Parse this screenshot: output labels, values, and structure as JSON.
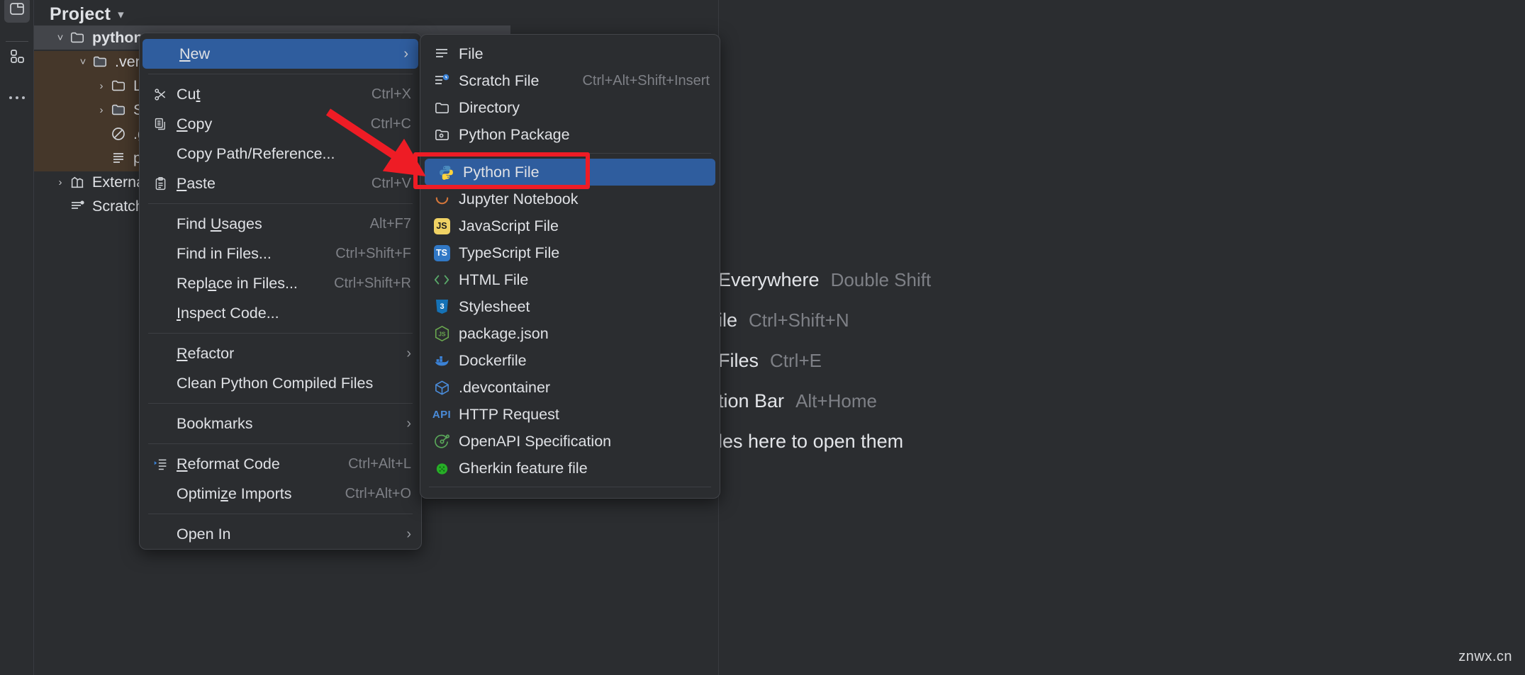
{
  "activity_bar": {
    "items": [
      {
        "name": "project-tool-window",
        "icon": "folder-icon",
        "selected": true
      },
      {
        "name": "structure-tool-window",
        "icon": "grid-squares-icon",
        "selected": false
      },
      {
        "name": "more-tool-windows",
        "icon": "ellipsis-icon",
        "selected": false
      }
    ]
  },
  "project_panel": {
    "title": "Project",
    "dropdown_icon": "chevron-down-icon",
    "tree": [
      {
        "label": "python",
        "bold": true,
        "expanded": true,
        "arrow": "chevron-down-icon",
        "icon": "folder-icon",
        "indent": 0,
        "selected": true,
        "highlighted": false
      },
      {
        "label": ".ven",
        "bold": false,
        "expanded": true,
        "arrow": "chevron-down-icon",
        "icon": "folder-icon",
        "indent": 1,
        "selected": false,
        "highlighted": true
      },
      {
        "label": "L",
        "bold": false,
        "expanded": false,
        "arrow": "chevron-right-icon",
        "icon": "folder-icon",
        "indent": 2,
        "selected": false,
        "highlighted": true
      },
      {
        "label": "S",
        "bold": false,
        "expanded": false,
        "arrow": "chevron-right-icon",
        "icon": "folder-icon",
        "indent": 2,
        "selected": false,
        "highlighted": true
      },
      {
        "label": ".g",
        "bold": false,
        "expanded": false,
        "arrow": "",
        "icon": "ignored-file-icon",
        "indent": 2,
        "selected": false,
        "highlighted": true
      },
      {
        "label": "p",
        "bold": false,
        "expanded": false,
        "arrow": "",
        "icon": "text-file-icon",
        "indent": 2,
        "selected": false,
        "highlighted": true
      },
      {
        "label": "Externa",
        "bold": false,
        "expanded": false,
        "arrow": "chevron-right-icon",
        "icon": "library-icon",
        "indent": 0,
        "selected": false,
        "highlighted": false
      },
      {
        "label": "Scratch",
        "bold": false,
        "expanded": false,
        "arrow": "",
        "icon": "scratch-icon",
        "indent": 0,
        "selected": false,
        "highlighted": false
      }
    ]
  },
  "context_menu": {
    "items": [
      {
        "type": "item",
        "label": "New",
        "mnemonic": "N",
        "icon": "",
        "shortcut": "",
        "submenu_arrow": "chevron-right-icon",
        "active": true
      },
      {
        "type": "separator"
      },
      {
        "type": "item",
        "label": "Cut",
        "mnemonic": "t",
        "icon": "scissors-icon",
        "shortcut": "Ctrl+X",
        "submenu_arrow": "",
        "active": false
      },
      {
        "type": "item",
        "label": "Copy",
        "mnemonic": "C",
        "icon": "copy-icon",
        "shortcut": "Ctrl+C",
        "submenu_arrow": "",
        "active": false
      },
      {
        "type": "item",
        "label": "Copy Path/Reference...",
        "mnemonic": "",
        "icon": "",
        "shortcut": "",
        "submenu_arrow": "",
        "active": false
      },
      {
        "type": "item",
        "label": "Paste",
        "mnemonic": "P",
        "icon": "clipboard-icon",
        "shortcut": "Ctrl+V",
        "submenu_arrow": "",
        "active": false
      },
      {
        "type": "separator"
      },
      {
        "type": "item",
        "label": "Find Usages",
        "mnemonic": "U",
        "icon": "",
        "shortcut": "Alt+F7",
        "submenu_arrow": "",
        "active": false
      },
      {
        "type": "item",
        "label": "Find in Files...",
        "mnemonic": "",
        "icon": "",
        "shortcut": "Ctrl+Shift+F",
        "submenu_arrow": "",
        "active": false
      },
      {
        "type": "item",
        "label": "Replace in Files...",
        "mnemonic": "a",
        "icon": "",
        "shortcut": "Ctrl+Shift+R",
        "submenu_arrow": "",
        "active": false
      },
      {
        "type": "item",
        "label": "Inspect Code...",
        "mnemonic": "I",
        "icon": "",
        "shortcut": "",
        "submenu_arrow": "",
        "active": false
      },
      {
        "type": "separator"
      },
      {
        "type": "item",
        "label": "Refactor",
        "mnemonic": "R",
        "icon": "",
        "shortcut": "",
        "submenu_arrow": "chevron-right-icon",
        "active": false
      },
      {
        "type": "item",
        "label": "Clean Python Compiled Files",
        "mnemonic": "",
        "icon": "",
        "shortcut": "",
        "submenu_arrow": "",
        "active": false
      },
      {
        "type": "separator"
      },
      {
        "type": "item",
        "label": "Bookmarks",
        "mnemonic": "",
        "icon": "",
        "shortcut": "",
        "submenu_arrow": "chevron-right-icon",
        "active": false
      },
      {
        "type": "separator"
      },
      {
        "type": "item",
        "label": "Reformat Code",
        "mnemonic": "R",
        "icon": "reformat-icon",
        "shortcut": "Ctrl+Alt+L",
        "submenu_arrow": "",
        "active": false
      },
      {
        "type": "item",
        "label": "Optimize Imports",
        "mnemonic": "z",
        "icon": "",
        "shortcut": "Ctrl+Alt+O",
        "submenu_arrow": "",
        "active": false
      },
      {
        "type": "separator"
      },
      {
        "type": "item",
        "label": "Open In",
        "mnemonic": "",
        "icon": "",
        "shortcut": "",
        "submenu_arrow": "chevron-right-icon",
        "active": false
      }
    ]
  },
  "submenu_new": {
    "items": [
      {
        "type": "item",
        "label": "File",
        "icon": "file-lines-icon",
        "shortcut": "",
        "active": false
      },
      {
        "type": "item",
        "label": "Scratch File",
        "icon": "scratch-file-icon",
        "shortcut": "Ctrl+Alt+Shift+Insert",
        "active": false
      },
      {
        "type": "item",
        "label": "Directory",
        "icon": "folder-icon",
        "shortcut": "",
        "active": false
      },
      {
        "type": "item",
        "label": "Python Package",
        "icon": "python-package-icon",
        "shortcut": "",
        "active": false
      },
      {
        "type": "separator"
      },
      {
        "type": "item",
        "label": "Python File",
        "icon": "python-icon",
        "shortcut": "",
        "active": true
      },
      {
        "type": "item",
        "label": "Jupyter Notebook",
        "icon": "jupyter-icon",
        "shortcut": "",
        "active": false
      },
      {
        "type": "item",
        "label": "JavaScript File",
        "icon": "javascript-icon",
        "shortcut": "",
        "active": false
      },
      {
        "type": "item",
        "label": "TypeScript File",
        "icon": "typescript-icon",
        "shortcut": "",
        "active": false
      },
      {
        "type": "item",
        "label": "HTML File",
        "icon": "html-icon",
        "shortcut": "",
        "active": false
      },
      {
        "type": "item",
        "label": "Stylesheet",
        "icon": "css-icon",
        "shortcut": "",
        "active": false
      },
      {
        "type": "item",
        "label": "package.json",
        "icon": "nodejs-icon",
        "shortcut": "",
        "active": false
      },
      {
        "type": "item",
        "label": "Dockerfile",
        "icon": "docker-icon",
        "shortcut": "",
        "active": false
      },
      {
        "type": "item",
        "label": ".devcontainer",
        "icon": "devcontainer-cube-icon",
        "shortcut": "",
        "active": false
      },
      {
        "type": "item",
        "label": "HTTP Request",
        "icon": "api-icon",
        "shortcut": "",
        "active": false
      },
      {
        "type": "item",
        "label": "OpenAPI Specification",
        "icon": "openapi-icon",
        "shortcut": "",
        "active": false
      },
      {
        "type": "item",
        "label": "Gherkin feature file",
        "icon": "cucumber-icon",
        "shortcut": "",
        "active": false
      },
      {
        "type": "separator"
      }
    ]
  },
  "editor_hints": {
    "lines": [
      {
        "text": "Everywhere",
        "shortcut": "Double Shift"
      },
      {
        "text": "ile",
        "shortcut": "Ctrl+Shift+N"
      },
      {
        "text": "Files",
        "shortcut": "Ctrl+E"
      },
      {
        "text": "tion Bar",
        "shortcut": "Alt+Home"
      },
      {
        "text": "les here to open them",
        "shortcut": ""
      }
    ]
  },
  "annotations": {
    "highlight_box_color": "#ee1c25",
    "arrow_color": "#ee1c25",
    "arrow_name": "red-pointer-arrow",
    "box_target": "Python File"
  },
  "watermark": {
    "text": "znwx.cn"
  },
  "colors": {
    "background": "#2b2d30",
    "menu_background": "#2b2d30",
    "selection_blue": "#2f5d9e",
    "tree_highlight": "#45372a",
    "text": "#dfe1e5",
    "muted_text": "#7e8086"
  }
}
